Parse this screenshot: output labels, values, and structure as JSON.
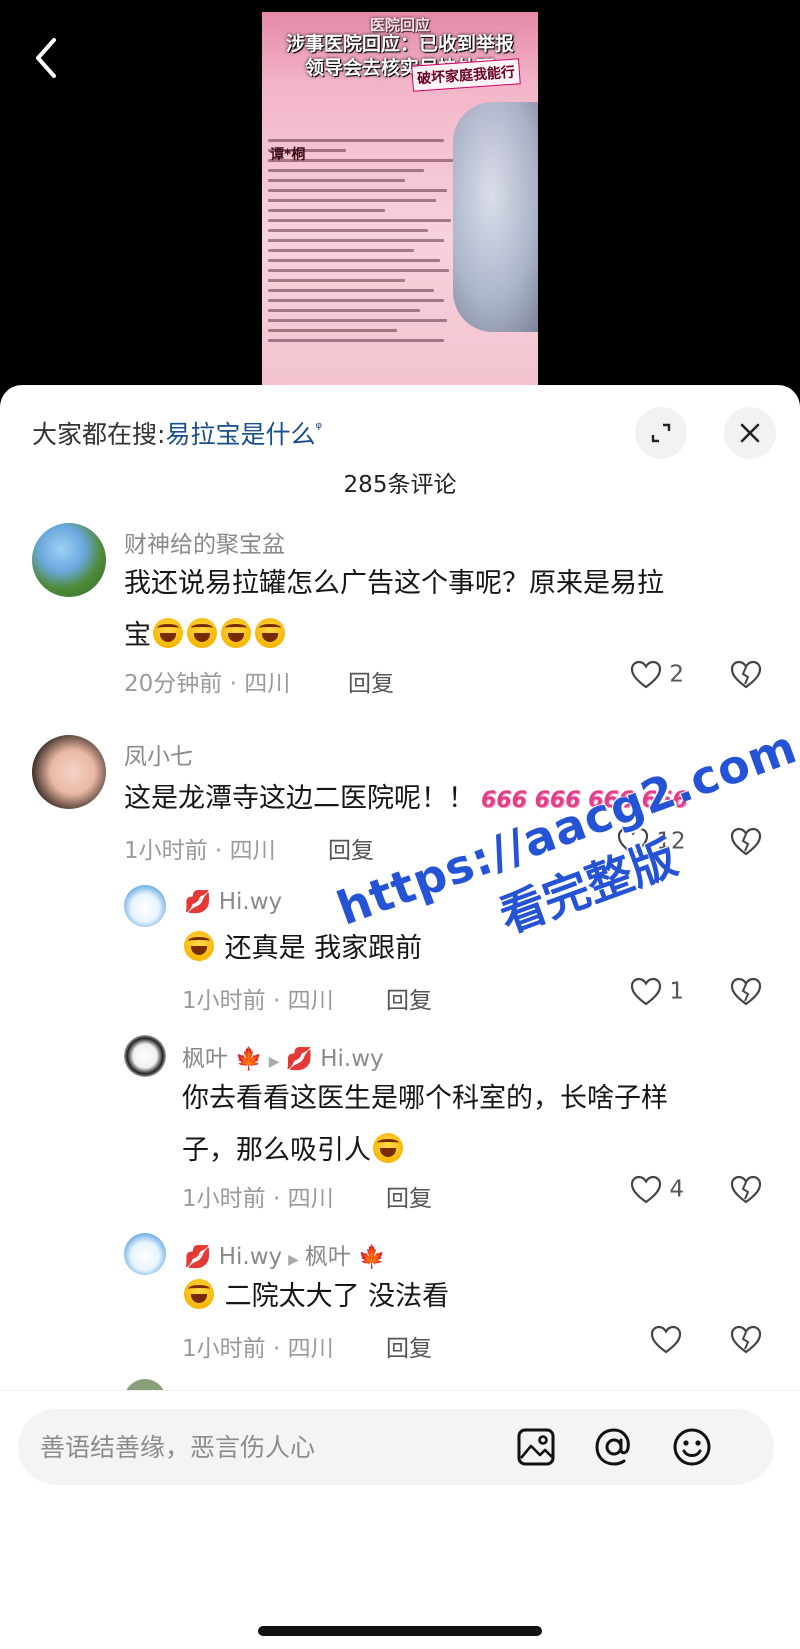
{
  "video": {
    "headline_line1": "医院回应",
    "headline_line2": "涉事医院回应：已收到举报",
    "headline_line3": "领导会去核实尽快处理",
    "sign_text": "破坏家庭我能行",
    "doc_name": "谭*桐"
  },
  "hot_search": {
    "prefix": "大家都在搜:",
    "keyword": "易拉宝是什么",
    "suffix_icon": "search-icon"
  },
  "comment_count": "285条评论",
  "comments": [
    {
      "user": "财神给的聚宝盆",
      "text_line1": "我还说易拉罐怎么广告这个事呢？原来是易拉",
      "text_line2": "宝",
      "meta": "20分钟前 · 四川",
      "reply": "回复",
      "likes": "2"
    },
    {
      "user": "凤小七",
      "text": "这是龙潭寺这边二医院呢！！",
      "stickers": "666 666 666 666",
      "meta": "1小时前 · 四川",
      "reply": "回复",
      "likes": "12"
    }
  ],
  "replies": [
    {
      "user": "Hi.wy",
      "text": "还真是 我家跟前",
      "meta": "1小时前 · 四川",
      "reply": "回复",
      "likes": "1"
    },
    {
      "user": "枫叶",
      "reply_to": "Hi.wy",
      "text_line1": "你去看看这医生是哪个科室的，长啥子样",
      "text_line2": "子，那么吸引人",
      "meta": "1小时前 · 四川",
      "reply": "回复",
      "likes": "4"
    },
    {
      "user": "Hi.wy",
      "reply_to": "枫叶",
      "text": "二院太大了 没法看",
      "meta": "1小时前 · 四川",
      "reply": "回复",
      "likes": ""
    }
  ],
  "watermark": {
    "line1": "https://aacg2.com",
    "line2": "看完整版"
  },
  "input": {
    "placeholder": "善语结善缘，恶言伤人心"
  },
  "icons": {
    "back": "chevron-left-icon",
    "expand": "expand-icon",
    "close": "close-icon",
    "like": "heart-icon",
    "dislike": "broken-heart-icon",
    "image": "image-icon",
    "mention": "at-icon",
    "emoji": "smiley-icon"
  },
  "colors": {
    "keyword": "#1a4f8c",
    "watermark": "#2553d6"
  }
}
